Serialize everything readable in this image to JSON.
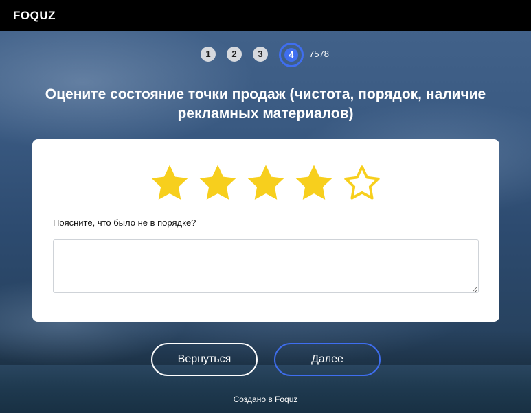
{
  "header": {
    "logo": "FOQUZ"
  },
  "steps": {
    "items": [
      "1",
      "2",
      "3",
      "4"
    ],
    "active": "4",
    "count_text": "7578"
  },
  "question": {
    "title": "Оцените состояние точки продаж (чистота, порядок, наличие рекламных материалов)"
  },
  "rating": {
    "value": 4,
    "max": 5,
    "filled_color": "#f7cf1d",
    "empty_color": "#f7cf1d"
  },
  "comment": {
    "label": "Поясните, что было не в порядке?",
    "value": ""
  },
  "buttons": {
    "back": "Вернуться",
    "next": "Далее"
  },
  "footer": {
    "link": "Создано в Foquz"
  },
  "colors": {
    "accent": "#3f6ef0",
    "topbar": "#000000",
    "card": "#ffffff"
  }
}
